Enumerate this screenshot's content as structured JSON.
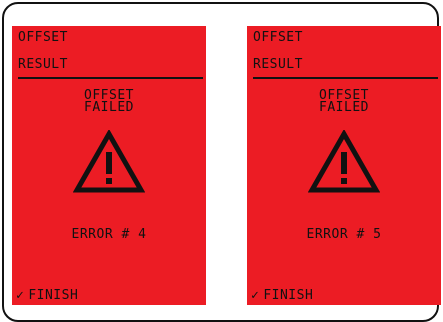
{
  "screens": [
    {
      "menu_item": "OFFSET",
      "section": "RESULT",
      "status_line1": "OFFSET",
      "status_line2": "FAILED",
      "error_text": "ERROR # 4",
      "finish_label": "FINISH",
      "warning_icon": "warning-triangle",
      "check_icon": "checkmark"
    },
    {
      "menu_item": "OFFSET",
      "section": "RESULT",
      "status_line1": "OFFSET",
      "status_line2": "FAILED",
      "error_text": "ERROR # 5",
      "finish_label": "FINISH",
      "warning_icon": "warning-triangle",
      "check_icon": "checkmark"
    }
  ],
  "colors": {
    "screen_background": "#ec1c24",
    "foreground": "#111111",
    "frame": "#111111"
  }
}
